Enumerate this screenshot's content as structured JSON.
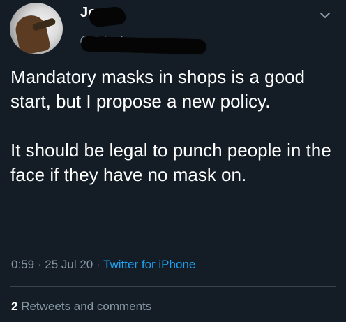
{
  "tweet": {
    "author": {
      "display_name": "Jo",
      "handle": "@Tobi_fro",
      "avatar": "profile-photo"
    },
    "menu_icon": "chevron-down-icon",
    "text": {
      "paragraph_1": "Mandatory masks in shops is a good start, but I propose a new policy.",
      "paragraph_2": "It should be legal to punch people in the face if they have no mask on."
    },
    "meta": {
      "time": "0:59",
      "separator": "·",
      "date": "25 Jul 20",
      "source": "Twitter for iPhone"
    },
    "engagement": {
      "count": "2",
      "label": "Retweets and comments"
    }
  },
  "colors": {
    "background": "#141d26",
    "text_primary": "#ffffff",
    "text_secondary": "#8899a6",
    "link": "#1da1f2",
    "divider": "#38444d",
    "redaction": "#050505"
  }
}
